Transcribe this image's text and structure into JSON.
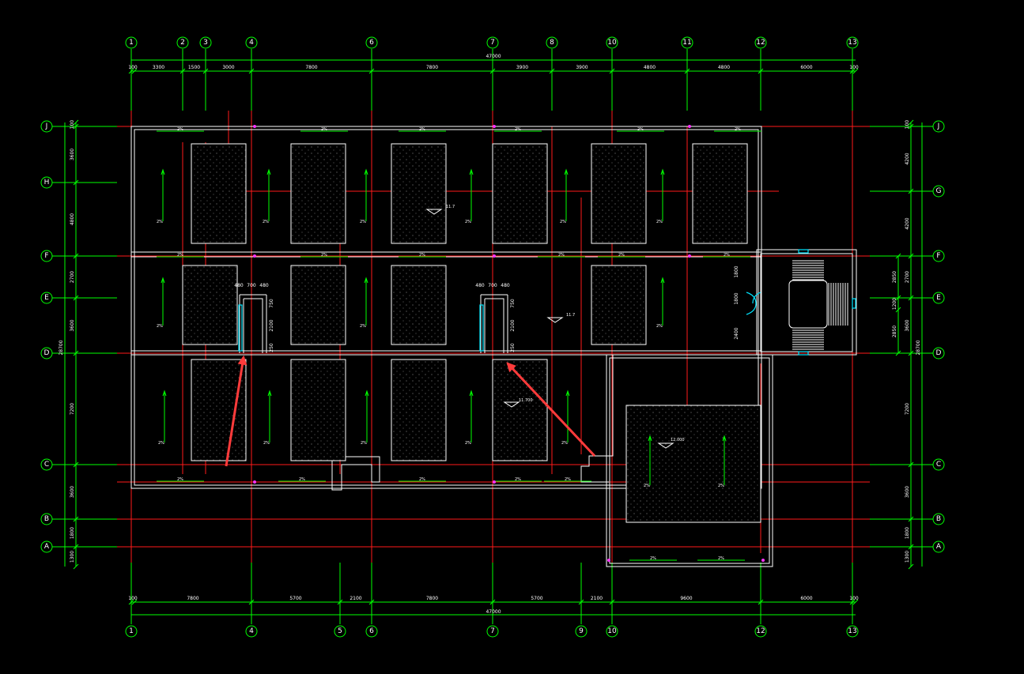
{
  "colors": {
    "background": "#000000",
    "axis": "#00ff00",
    "ridge": "#ff1a1a",
    "outline": "#ffffff",
    "door": "#00e5ff",
    "annotation_arrow": "#ff3b3b"
  },
  "axes": {
    "top": [
      "1",
      "2",
      "3",
      "4",
      "6",
      "7",
      "8",
      "10",
      "11",
      "12",
      "13"
    ],
    "bottom": [
      "1",
      "4",
      "5",
      "6",
      "7",
      "9",
      "10",
      "12",
      "13"
    ],
    "left": [
      "J",
      "H",
      "F",
      "E",
      "D",
      "C",
      "B",
      "A"
    ],
    "right": [
      "J",
      "G",
      "F",
      "E",
      "D",
      "C",
      "B",
      "A"
    ]
  },
  "dims": {
    "top_total": "47000",
    "bottom_total": "47000",
    "top_segments": [
      "100",
      "3300",
      "1500",
      "3000",
      "7800",
      "7800",
      "3900",
      "3900",
      "4800",
      "4800",
      "6000",
      "100"
    ],
    "bottom_segments": [
      "100",
      "7800",
      "5700",
      "2100",
      "7800",
      "5700",
      "2100",
      "9600",
      "6000",
      "100"
    ],
    "left_segments": [
      "100",
      "3600",
      "4800",
      "2700",
      "3600",
      "7200",
      "3600",
      "1800",
      "1300"
    ],
    "left_total": "28700",
    "right_segments": [
      "100",
      "4200",
      "4200",
      "2700",
      "3600",
      "7200",
      "3600",
      "1800",
      "1300"
    ],
    "right_total": "28700",
    "right_inner": [
      "2850",
      "1200",
      "2850"
    ]
  },
  "labels": {
    "slope": "2%",
    "elev_a": "11.7",
    "elev_b": "11.700",
    "elev_c": "12.000",
    "opening_a": [
      "480",
      "700",
      "480"
    ],
    "opening_b": [
      "480",
      "700",
      "480"
    ],
    "opening_h": [
      "750",
      "2100",
      "250"
    ],
    "stair_dims": [
      "1800",
      "1800",
      "2400"
    ]
  }
}
